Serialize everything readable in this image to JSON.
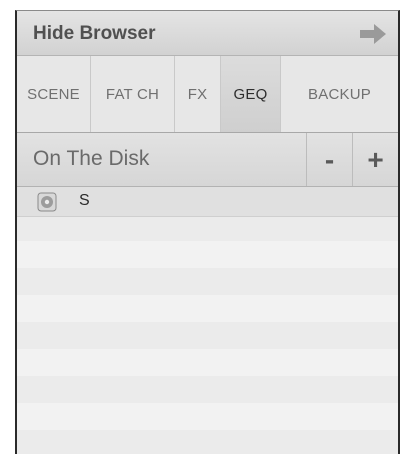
{
  "header": {
    "title": "Hide Browser",
    "arrow_icon": "arrow-right-icon"
  },
  "tabs": [
    {
      "label": "SCENE",
      "active": false
    },
    {
      "label": "FAT CH",
      "active": false
    },
    {
      "label": "FX",
      "active": false
    },
    {
      "label": "GEQ",
      "active": true
    },
    {
      "label": "BACKUP",
      "active": false
    }
  ],
  "disk_bar": {
    "label": "On The Disk",
    "minus_label": "-",
    "plus_label": "+"
  },
  "list": {
    "items": [
      {
        "icon": "disk-icon",
        "name": "S"
      }
    ]
  }
}
